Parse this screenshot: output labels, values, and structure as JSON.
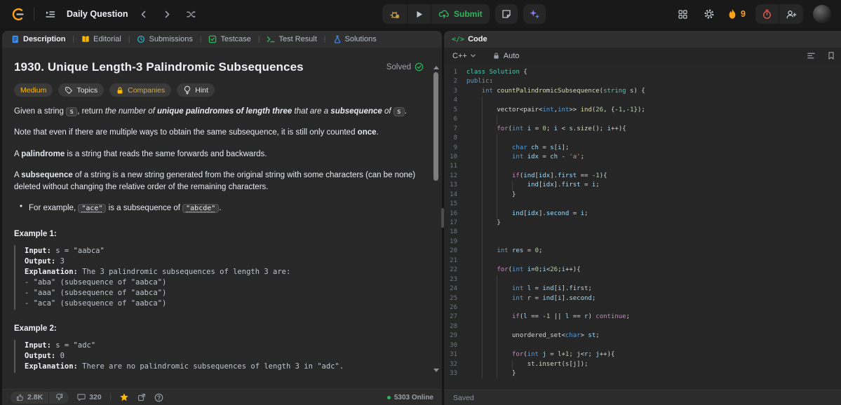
{
  "topbar": {
    "nav_label": "Daily Question",
    "submit_label": "Submit",
    "streak_count": "9"
  },
  "left_panel": {
    "tabs": [
      {
        "label": "Description",
        "icon": "doc-icon",
        "color": "#3e90f0",
        "active": true
      },
      {
        "label": "Editorial",
        "icon": "book-icon",
        "color": "#ffb800",
        "active": false
      },
      {
        "label": "Submissions",
        "icon": "history-icon",
        "color": "#2fb3c7",
        "active": false
      },
      {
        "label": "Testcase",
        "icon": "check-square-icon",
        "color": "#2db55d",
        "active": false
      },
      {
        "label": "Test Result",
        "icon": "terminal-icon",
        "color": "#2db55d",
        "active": false
      },
      {
        "label": "Solutions",
        "icon": "flask-icon",
        "color": "#3e90f0",
        "active": false
      }
    ],
    "title": "1930. Unique Length-3 Palindromic Subsequences",
    "solved_label": "Solved",
    "badges": {
      "difficulty": "Medium",
      "topics": "Topics",
      "companies": "Companies",
      "hint": "Hint"
    },
    "paragraphs": [
      {
        "type": "p",
        "segments": [
          {
            "t": "Given a string ",
            "s": "p"
          },
          {
            "t": "s",
            "s": "c"
          },
          {
            "t": ", return ",
            "s": "p"
          },
          {
            "t": "the number of ",
            "s": "i"
          },
          {
            "t": "unique palindromes of length three",
            "s": "bi"
          },
          {
            "t": " that are a ",
            "s": "i"
          },
          {
            "t": "subsequence",
            "s": "bi"
          },
          {
            "t": " of ",
            "s": "i"
          },
          {
            "t": "s",
            "s": "c"
          },
          {
            "t": ".",
            "s": "p"
          }
        ]
      },
      {
        "type": "p",
        "segments": [
          {
            "t": "Note that even if there are multiple ways to obtain the same subsequence, it is still only counted ",
            "s": "p"
          },
          {
            "t": "once",
            "s": "b"
          },
          {
            "t": ".",
            "s": "p"
          }
        ]
      },
      {
        "type": "p",
        "segments": [
          {
            "t": "A ",
            "s": "p"
          },
          {
            "t": "palindrome",
            "s": "b"
          },
          {
            "t": " is a string that reads the same forwards and backwards.",
            "s": "p"
          }
        ]
      },
      {
        "type": "p",
        "segments": [
          {
            "t": "A ",
            "s": "p"
          },
          {
            "t": "subsequence",
            "s": "b"
          },
          {
            "t": " of a string is a new string generated from the original string with some characters (can be none) deleted without changing the relative order of the remaining characters.",
            "s": "p"
          }
        ]
      },
      {
        "type": "bullet",
        "segments": [
          {
            "t": "For example, ",
            "s": "p"
          },
          {
            "t": "\"ace\"",
            "s": "cu"
          },
          {
            "t": " is a subsequence of ",
            "s": "p"
          },
          {
            "t": "\"abcde\"",
            "s": "cu"
          },
          {
            "t": ".",
            "s": "p"
          }
        ]
      }
    ],
    "examples": [
      {
        "label": "Example 1:",
        "lines": [
          [
            {
              "t": "Input:",
              "b": true
            },
            {
              "t": " s = \"aabca\""
            }
          ],
          [
            {
              "t": "Output:",
              "b": true
            },
            {
              "t": " 3"
            }
          ],
          [
            {
              "t": "Explanation:",
              "b": true
            },
            {
              "t": " The 3 palindromic subsequences of length 3 are:"
            }
          ],
          [
            {
              "t": "- \"aba\" (subsequence of \"aabca\")"
            }
          ],
          [
            {
              "t": "- \"aaa\" (subsequence of \"aabca\")"
            }
          ],
          [
            {
              "t": "- \"aca\" (subsequence of \"aabca\")"
            }
          ]
        ]
      },
      {
        "label": "Example 2:",
        "lines": [
          [
            {
              "t": "Input:",
              "b": true
            },
            {
              "t": " s = \"adc\""
            }
          ],
          [
            {
              "t": "Output:",
              "b": true
            },
            {
              "t": " 0"
            }
          ],
          [
            {
              "t": "Explanation:",
              "b": true
            },
            {
              "t": " There are no palindromic subsequences of length 3 in \"adc\"."
            }
          ]
        ]
      }
    ],
    "footer": {
      "likes": "2.8K",
      "comments": "320",
      "online": "5303 Online"
    }
  },
  "right_panel": {
    "header_label": "Code",
    "code_glyph": "</>",
    "language": "C++",
    "auto_label": "Auto",
    "saved_label": "Saved",
    "code_lines": [
      "class Solution {",
      "public:",
      "    int countPalindromicSubsequence(string s) {",
      "        ",
      "        vector<pair<int,int>> ind(26, {-1,-1});",
      "            ",
      "        for(int i = 0; i < s.size(); i++){",
      "            ",
      "            char ch = s[i];",
      "            int idx = ch - 'a';",
      "            ",
      "            if(ind[idx].first == -1){",
      "                ind[idx].first = i;",
      "            }",
      "            ",
      "            ind[idx].second = i;",
      "        }",
      "        ",
      "        ",
      "        int res = 0;",
      "        ",
      "        for(int i=0;i<26;i++){",
      "            ",
      "            int l = ind[i].first;",
      "            int r = ind[i].second;",
      "            ",
      "            if(l == -1 || l == r) continue;",
      "            ",
      "            unordered_set<char> st;",
      "            ",
      "            for(int j = l+1; j<r; j++){",
      "                st.insert(s[j]);",
      "            }"
    ]
  },
  "colors": {
    "accent_green": "#2db55d",
    "difficulty_medium": "#ffb800",
    "flame_orange": "#ffa116",
    "timer_red": "#e2574c",
    "sparkle_purple": "#8c7ae6",
    "sparkle_blue": "#5b8def",
    "syntax": {
      "keyword": "#569cd6",
      "control": "#c586c0",
      "type": "#4ec9b0",
      "function": "#dcdcaa",
      "variable": "#9cdcfe",
      "number": "#b5cea8",
      "string": "#ce9178",
      "plain": "#d4d4d4"
    }
  }
}
